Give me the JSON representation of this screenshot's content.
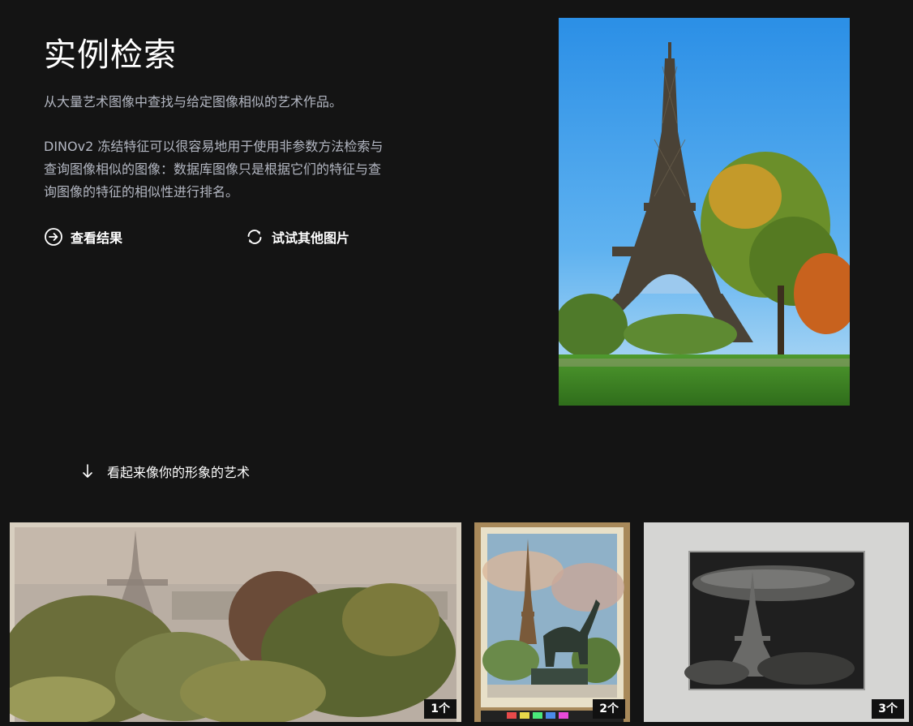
{
  "page": {
    "title": "实例检索",
    "subtitle": "从大量艺术图像中查找与给定图像相似的艺术作品。",
    "description": "DINOv2 冻结特征可以很容易地用于使用非参数方法检索与查询图像相似的图像：数据库图像只是根据它们的特征与查询图像的特征的相似性进行排名。"
  },
  "actions": {
    "view_results": {
      "label": "查看结果",
      "icon": "arrow-circle-right-icon"
    },
    "try_other": {
      "label": "试试其他图片",
      "icon": "refresh-icon"
    }
  },
  "results_section": {
    "label": "看起来像你的形象的艺术",
    "icon": "arrow-down-icon"
  },
  "results": [
    {
      "rank_label": "1个"
    },
    {
      "rank_label": "2个"
    },
    {
      "rank_label": "3个"
    }
  ],
  "colors": {
    "background": "#141414",
    "text": "#ffffff",
    "muted_text": "#b3b7c2",
    "badge": "#111111"
  }
}
